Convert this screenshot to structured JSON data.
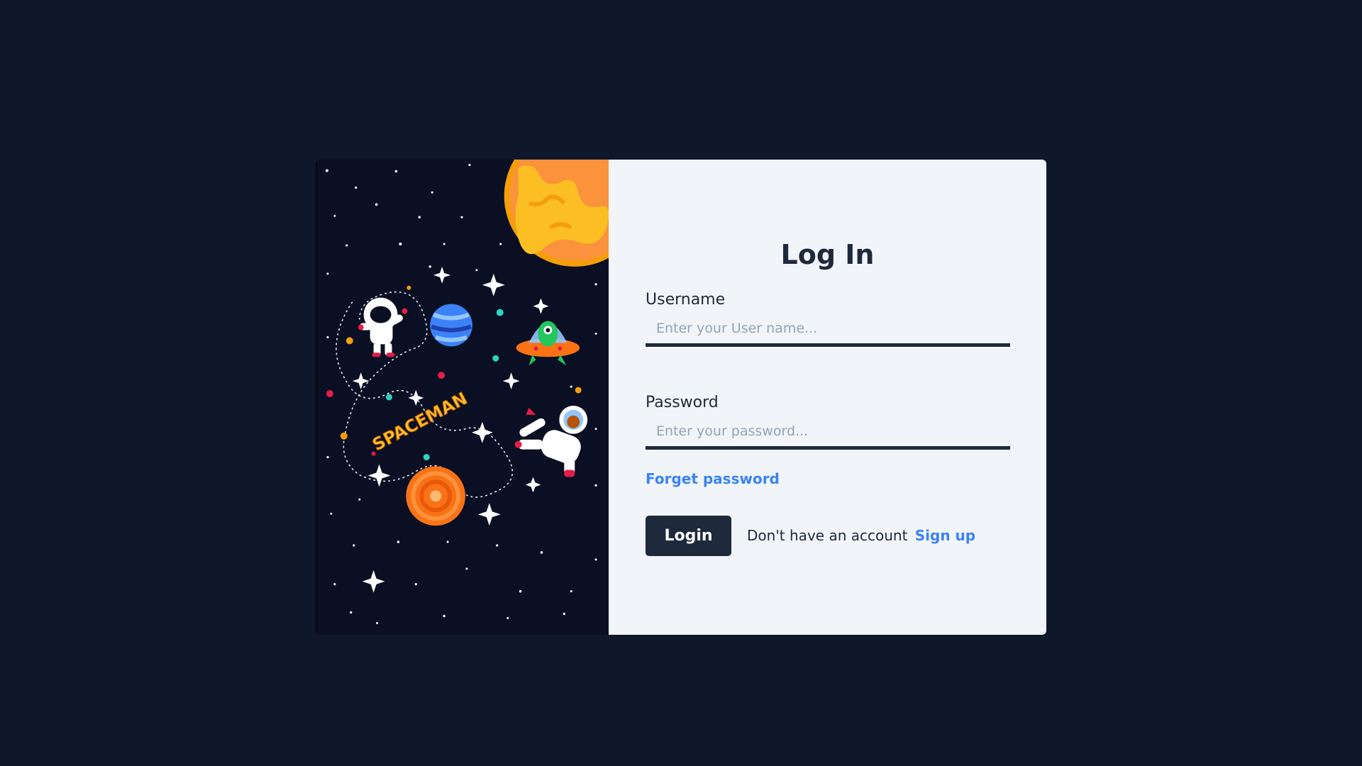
{
  "colors": {
    "background": "#0f172a",
    "panel": "#f1f5f9",
    "primary": "#1e293b",
    "link": "#3b82f6",
    "art_background": "#0b0f23"
  },
  "illustration": {
    "text": "SPACEMAN",
    "icons": [
      "sun-icon",
      "astronaut-icon",
      "alien-ufo-icon",
      "planet-icon",
      "star-icon"
    ]
  },
  "form": {
    "title": "Log In",
    "username": {
      "label": "Username",
      "placeholder": "Enter your User name...",
      "value": ""
    },
    "password": {
      "label": "Password",
      "placeholder": "Enter your password...",
      "value": ""
    },
    "forgot_label": "Forget password",
    "login_label": "Login",
    "signup_prompt": "Don't have an account",
    "signup_label": "Sign up"
  }
}
